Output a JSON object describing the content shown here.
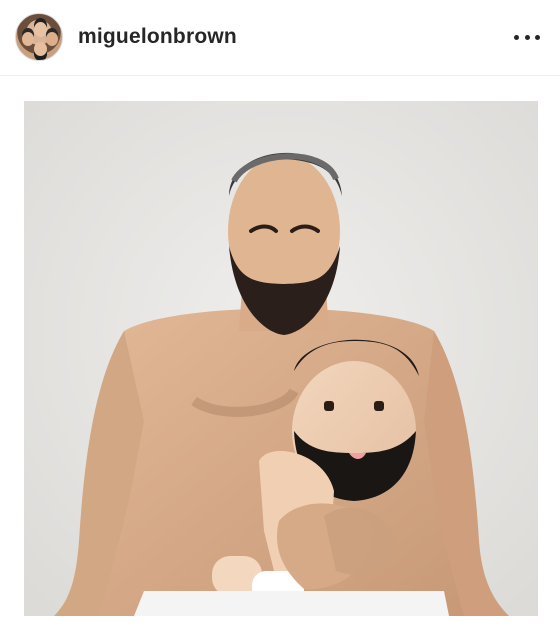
{
  "post": {
    "username": "miguelonbrown",
    "avatar_icon": "profile-avatar-icon",
    "more_icon": "more-options-icon",
    "photo_icon": "post-photo"
  },
  "colors": {
    "background": "#ffffff",
    "text": "#262626",
    "divider": "#efefef",
    "wall": "#e9e8e6"
  }
}
